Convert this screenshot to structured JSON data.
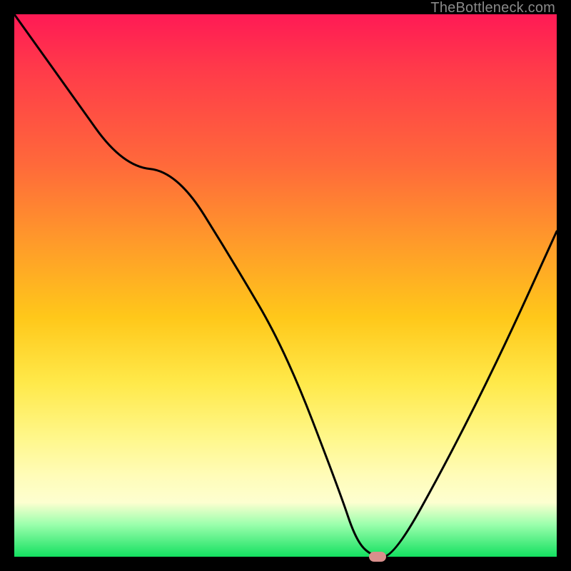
{
  "attribution": "TheBottleneck.com",
  "chart_data": {
    "type": "line",
    "title": "",
    "xlabel": "",
    "ylabel": "",
    "xlim": [
      0,
      100
    ],
    "ylim": [
      0,
      100
    ],
    "x": [
      0,
      5,
      10,
      20,
      30,
      40,
      50,
      60,
      63,
      66,
      70,
      80,
      90,
      100
    ],
    "values": [
      100,
      93,
      86,
      72,
      71,
      55,
      38,
      12,
      3,
      0,
      0,
      18,
      38,
      60
    ],
    "series": [
      {
        "name": "bottleneck-curve",
        "x": [
          0,
          5,
          10,
          20,
          30,
          40,
          50,
          60,
          63,
          66,
          70,
          80,
          90,
          100
        ],
        "values": [
          100,
          93,
          86,
          72,
          71,
          55,
          38,
          12,
          3,
          0,
          0,
          18,
          38,
          60
        ]
      }
    ],
    "marker": {
      "x": 67,
      "y": 0
    },
    "colors": {
      "line": "#000000",
      "gradient_top": "#ff1a55",
      "gradient_bottom": "#13e060",
      "marker": "#d88f8c",
      "background_frame": "#000000"
    }
  }
}
